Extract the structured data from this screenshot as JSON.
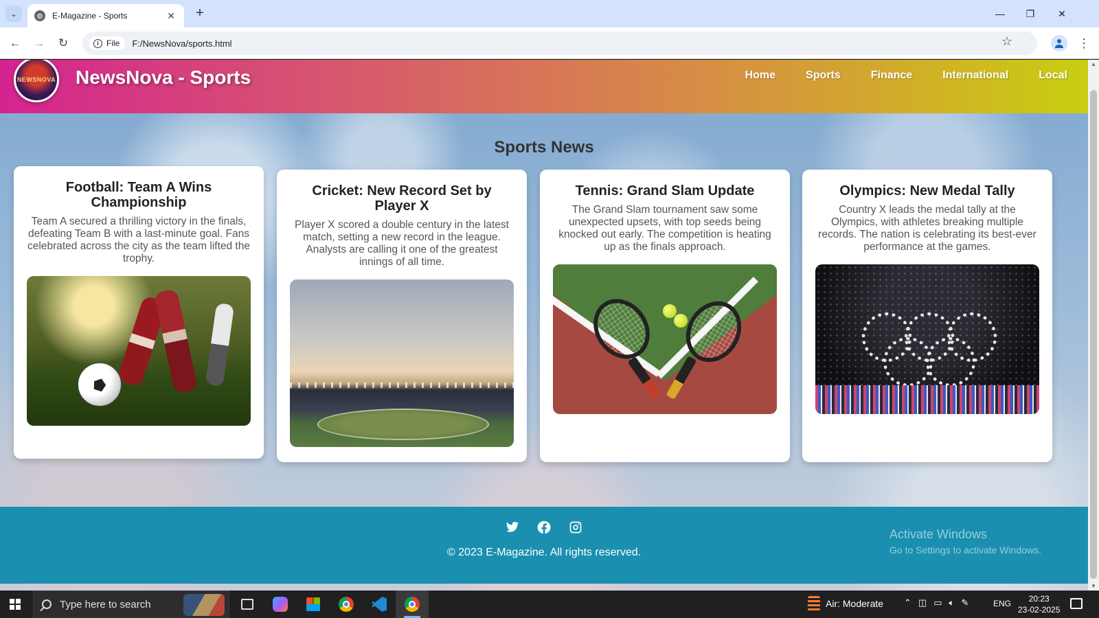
{
  "browser": {
    "tab_title": "E-Magazine - Sports",
    "chip_label": "File",
    "url": "F:/NewsNova/sports.html"
  },
  "site": {
    "logo_text": "NEWSNOVA",
    "title": "NewsNova - Sports",
    "nav": [
      "Home",
      "Sports",
      "Finance",
      "International",
      "Local"
    ],
    "section_title": "Sports News"
  },
  "articles": [
    {
      "title": "Football: Team A Wins Championship",
      "body": "Team A secured a thrilling victory in the finals, defeating Team B with a last-minute goal. Fans celebrated across the city as the team lifted the trophy.",
      "image": "football-match"
    },
    {
      "title": "Cricket: New Record Set by Player X",
      "body": "Player X scored a double century in the latest match, setting a new record in the league. Analysts are calling it one of the greatest innings of all time.",
      "image": "cricket-stadium"
    },
    {
      "title": "Tennis: Grand Slam Update",
      "body": "The Grand Slam tournament saw some unexpected upsets, with top seeds being knocked out early. The competition is heating up as the finals approach.",
      "image": "tennis-rackets"
    },
    {
      "title": "Olympics: New Medal Tally",
      "body": "Country X leads the medal tally at the Olympics, with athletes breaking multiple records. The nation is celebrating its best-ever performance at the games.",
      "image": "olympic-rings"
    }
  ],
  "footer": {
    "social_icons": [
      "twitter-icon",
      "facebook-icon",
      "instagram-icon"
    ],
    "copyright": "© 2023 E-Magazine. All rights reserved.",
    "activate_title": "Activate Windows",
    "activate_sub": "Go to Settings to activate Windows."
  },
  "taskbar": {
    "search_placeholder": "Type here to search",
    "air_quality": "Air: Moderate",
    "language": "ENG",
    "time": "20:23",
    "date": "23-02-2025"
  },
  "colors": {
    "header_gradient": [
      "#d4248f",
      "#d7864b",
      "#c8cf10"
    ],
    "footer_bg": "#1a8fb0"
  }
}
